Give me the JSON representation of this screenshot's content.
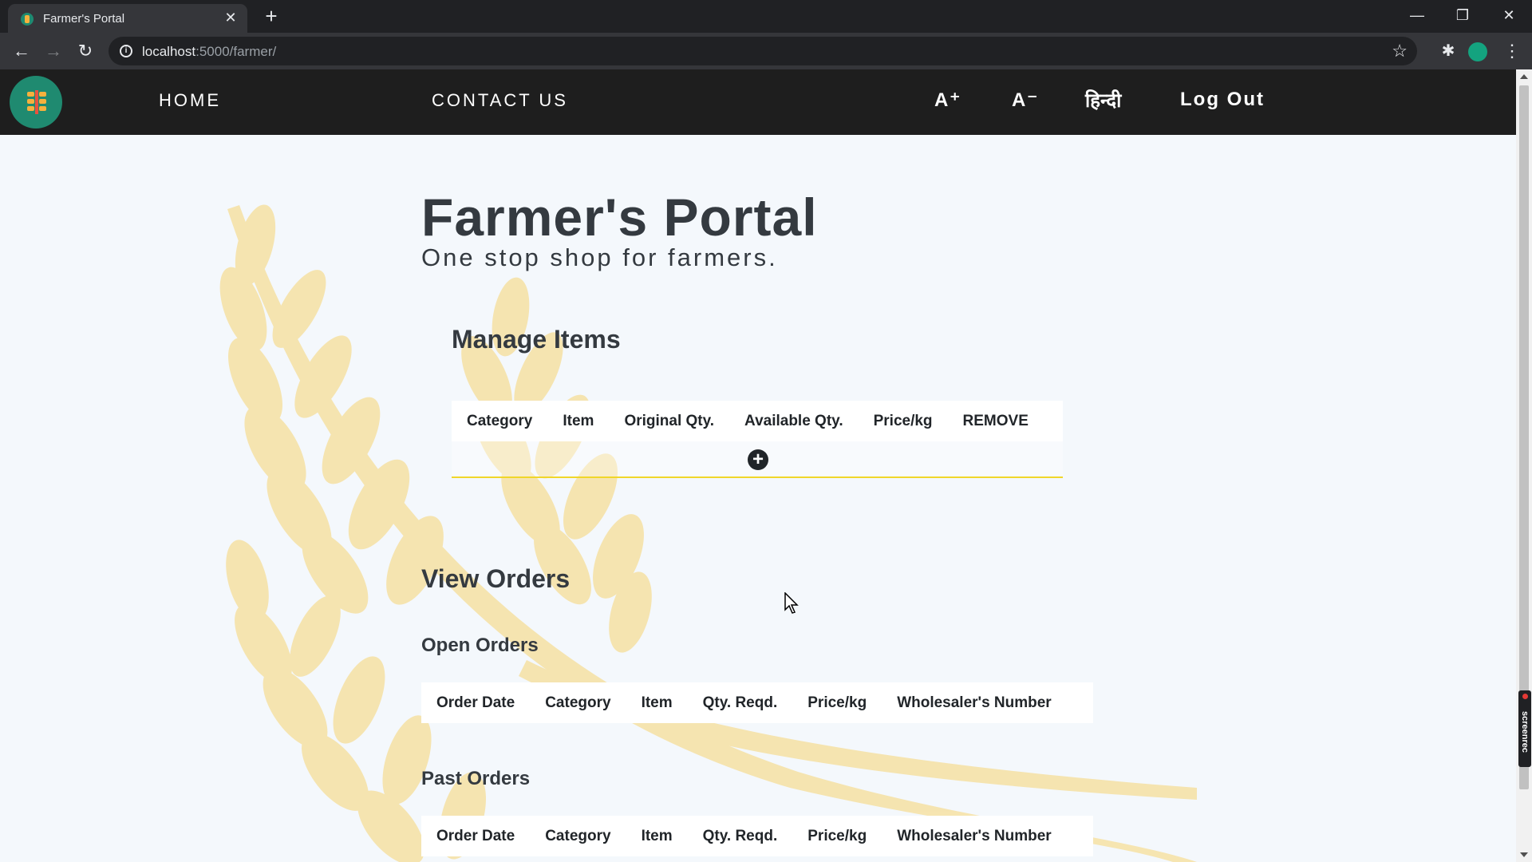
{
  "browser": {
    "tab_title": "Farmer's Portal",
    "tab_close": "✕",
    "new_tab": "+",
    "url_host": "localhost",
    "url_path": ":5000/farmer/",
    "win_min": "—",
    "win_restore": "❐",
    "win_close": "✕",
    "back": "←",
    "forward": "→",
    "reload": "↻",
    "info": "i",
    "star": "☆",
    "extensions": "✱",
    "menu": "⋮"
  },
  "nav": {
    "home": "HOME",
    "contact": "CONTACT US",
    "font_increase": "A⁺",
    "font_decrease": "A⁻",
    "language": "हिन्दी",
    "logout": "Log Out"
  },
  "hero": {
    "title": "Farmer's Portal",
    "subtitle": "One stop shop for farmers."
  },
  "manage_items": {
    "title": "Manage Items",
    "columns": [
      "Category",
      "Item",
      "Original Qty.",
      "Available Qty.",
      "Price/kg",
      "REMOVE"
    ],
    "add_symbol": "+"
  },
  "orders": {
    "title": "View Orders",
    "open": {
      "title": "Open Orders",
      "columns": [
        "Order Date",
        "Category",
        "Item",
        "Qty. Reqd.",
        "Price/kg",
        "Wholesaler's Number"
      ]
    },
    "past": {
      "title": "Past Orders",
      "columns": [
        "Order Date",
        "Category",
        "Item",
        "Qty. Reqd.",
        "Price/kg",
        "Wholesaler's Number"
      ]
    }
  },
  "recorder": {
    "label": "screenrec"
  },
  "colors": {
    "nav_bg": "#1e1e1e",
    "page_bg": "#f4f8fc",
    "logo_bg": "#1f8a70",
    "heading": "#343a40",
    "wheat": "#f6e2a8",
    "accent_border": "#f0d62a"
  }
}
